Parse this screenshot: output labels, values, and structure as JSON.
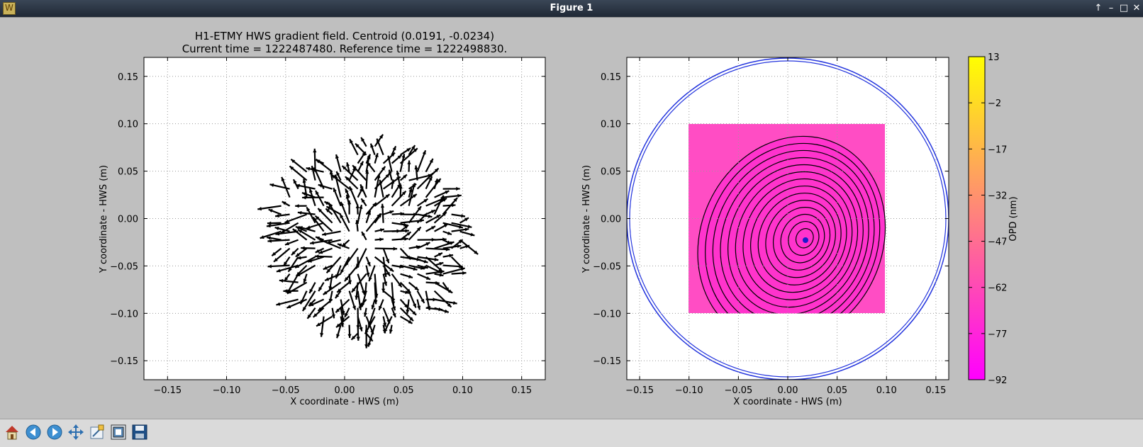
{
  "window": {
    "title": "Figure 1",
    "app_icon": "W"
  },
  "titlebar_buttons": [
    "↑",
    "–",
    "□",
    "✕"
  ],
  "left_plot": {
    "title_line1": "H1-ETMY HWS gradient field. Centroid (0.0191, -0.0234)",
    "title_line2": "Current time = 1222487480. Reference time = 1222498830.",
    "xlabel": "X coordinate - HWS (m)",
    "ylabel": "Y coordinate - HWS (m)",
    "xticks": [
      "−0.15",
      "−0.10",
      "−0.05",
      "0.00",
      "0.05",
      "0.10",
      "0.15"
    ],
    "yticks": [
      "0.15",
      "0.10",
      "0.05",
      "0.00",
      "−0.05",
      "−0.10",
      "−0.15"
    ]
  },
  "right_plot": {
    "xlabel": "X coordinate - HWS (m)",
    "ylabel": "Y coordinate - HWS (m)",
    "xticks": [
      "−0.15",
      "−0.10",
      "−0.05",
      "0.00",
      "0.05",
      "0.10",
      "0.15"
    ],
    "yticks": [
      "0.15",
      "0.10",
      "0.05",
      "0.00",
      "−0.05",
      "−0.10",
      "−0.15"
    ],
    "colorbar_label": "OPD (nm)",
    "colorbar_ticks": [
      "13",
      "−2",
      "−17",
      "−32",
      "−47",
      "−62",
      "−77",
      "−92"
    ]
  },
  "chart_data": [
    {
      "type": "scatter",
      "kind": "quiver",
      "title": "H1-ETMY HWS gradient field. Centroid (0.0191, -0.0234)\nCurrent time = 1222487480. Reference time = 1222498830.",
      "xlabel": "X coordinate - HWS (m)",
      "ylabel": "Y coordinate - HWS (m)",
      "xlim": [
        -0.17,
        0.17
      ],
      "ylim": [
        -0.17,
        0.17
      ],
      "grid": true,
      "field_center": [
        0.0191,
        -0.0234
      ],
      "field_radius": 0.08
    },
    {
      "type": "heatmap",
      "kind": "contourf",
      "xlabel": "X coordinate - HWS (m)",
      "ylabel": "Y coordinate - HWS (m)",
      "xlim": [
        -0.163,
        0.163
      ],
      "ylim": [
        -0.17,
        0.17
      ],
      "grid": true,
      "data_extent": {
        "x": [
          -0.1,
          0.1
        ],
        "y": [
          -0.1,
          0.1
        ]
      },
      "peak": [
        0.0191,
        -0.0234
      ],
      "value_range": [
        -92,
        13
      ],
      "colorbar_label": "OPD (nm)",
      "colorbar_ticks": [
        13,
        -2,
        -17,
        -32,
        -47,
        -62,
        -77,
        -92
      ],
      "aperture_circle_radius": 0.17,
      "colors": {
        "low": "#ff00ff",
        "high": "#ffff00",
        "circle": "#0000ff"
      }
    }
  ],
  "toolbar": {
    "buttons": [
      {
        "name": "home-icon"
      },
      {
        "name": "back-icon"
      },
      {
        "name": "forward-icon"
      },
      {
        "name": "pan-icon"
      },
      {
        "name": "zoom-icon"
      },
      {
        "name": "subplots-icon"
      },
      {
        "name": "save-icon"
      }
    ]
  }
}
